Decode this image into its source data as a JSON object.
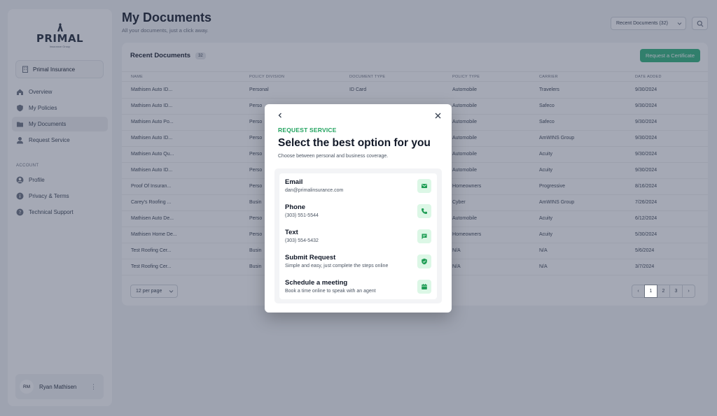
{
  "brand": {
    "name": "PRIMAL",
    "tagline": "Insurance Group"
  },
  "sidebar": {
    "company": "Primal Insurance",
    "nav": [
      {
        "label": "Overview",
        "icon": "home-icon",
        "active": false
      },
      {
        "label": "My Policies",
        "icon": "shield-icon",
        "active": false
      },
      {
        "label": "My Documents",
        "icon": "folder-icon",
        "active": true
      },
      {
        "label": "Request Service",
        "icon": "agent-icon",
        "active": false
      }
    ],
    "account_heading": "ACCOUNT",
    "account_nav": [
      {
        "label": "Profile",
        "icon": "user-icon"
      },
      {
        "label": "Privacy & Terms",
        "icon": "info-icon"
      },
      {
        "label": "Technical Support",
        "icon": "help-icon"
      }
    ],
    "user": {
      "initials": "RM",
      "name": "Ryan Mathisen",
      "menu": "⋮"
    }
  },
  "header": {
    "title": "My Documents",
    "subtitle": "All your documents, just a click away.",
    "filter_value": "Recent Documents (32)"
  },
  "panel": {
    "title": "Recent Documents",
    "count": "32",
    "action_label": "Request a Certificate",
    "columns": [
      "NAME",
      "POLICY DIVISION",
      "DOCUMENT TYPE",
      "POLICY TYPE",
      "CARRIER",
      "DATE ADDED"
    ],
    "rows": [
      [
        "Mathisen Auto ID...",
        "Personal",
        "ID Card",
        "Automobile",
        "Travelers",
        "9/30/2024"
      ],
      [
        "Mathisen Auto ID...",
        "Perso",
        "",
        "Automobile",
        "Safeco",
        "9/30/2024"
      ],
      [
        "Mathisen Auto Po...",
        "Perso",
        "",
        "Automobile",
        "Safeco",
        "9/30/2024"
      ],
      [
        "Mathisen Auto ID...",
        "Perso",
        "",
        "Automobile",
        "AmWINS Group",
        "9/30/2024"
      ],
      [
        "Mathisen Auto Qu...",
        "Perso",
        "",
        "Automobile",
        "Acuity",
        "9/30/2024"
      ],
      [
        "Mathisen Auto ID...",
        "Perso",
        "",
        "Automobile",
        "Acuity",
        "9/30/2024"
      ],
      [
        "Proof Of Insuran...",
        "Perso",
        "",
        "Homeowners",
        "Progressive",
        "8/16/2024"
      ],
      [
        "Carey's Roofing ...",
        "Busin",
        "",
        "Cyber",
        "AmWINS Group",
        "7/26/2024"
      ],
      [
        "Mathisen Auto De...",
        "Perso",
        "",
        "Automobile",
        "Acuity",
        "6/12/2024"
      ],
      [
        "Mathisen Home De...",
        "Perso",
        "",
        "Homeowners",
        "Acuity",
        "5/30/2024"
      ],
      [
        "Test Roofing Cer...",
        "Busin",
        "",
        "N/A",
        "N/A",
        "5/6/2024"
      ],
      [
        "Test Roofing Cer...",
        "Busin",
        "",
        "N/A",
        "N/A",
        "3/7/2024"
      ]
    ],
    "per_page": "12 per page",
    "pages": [
      "‹",
      "1",
      "2",
      "3",
      "›"
    ],
    "current_page": "1"
  },
  "modal": {
    "eyebrow": "REQUEST SERVICE",
    "title": "Select the best option for you",
    "subtitle": "Choose between personal and business coverage.",
    "options": [
      {
        "label": "Email",
        "detail": "dan@primalinsurance.com",
        "icon": "mail-icon"
      },
      {
        "label": "Phone",
        "detail": "(303) 551-5544",
        "icon": "phone-icon"
      },
      {
        "label": "Text",
        "detail": "(303) 554-5432",
        "icon": "message-icon"
      },
      {
        "label": "Submit Request",
        "detail": "Simple and easy, just complete the steps online",
        "icon": "shield-check-icon"
      },
      {
        "label": "Schedule a meeting",
        "detail": "Book a time online to speak with an agent",
        "icon": "calendar-icon"
      }
    ]
  },
  "colors": {
    "accent": "#22a35f",
    "accent_bg": "#dcf7e6",
    "button": "#2db37a",
    "overlay": "#37415a"
  }
}
